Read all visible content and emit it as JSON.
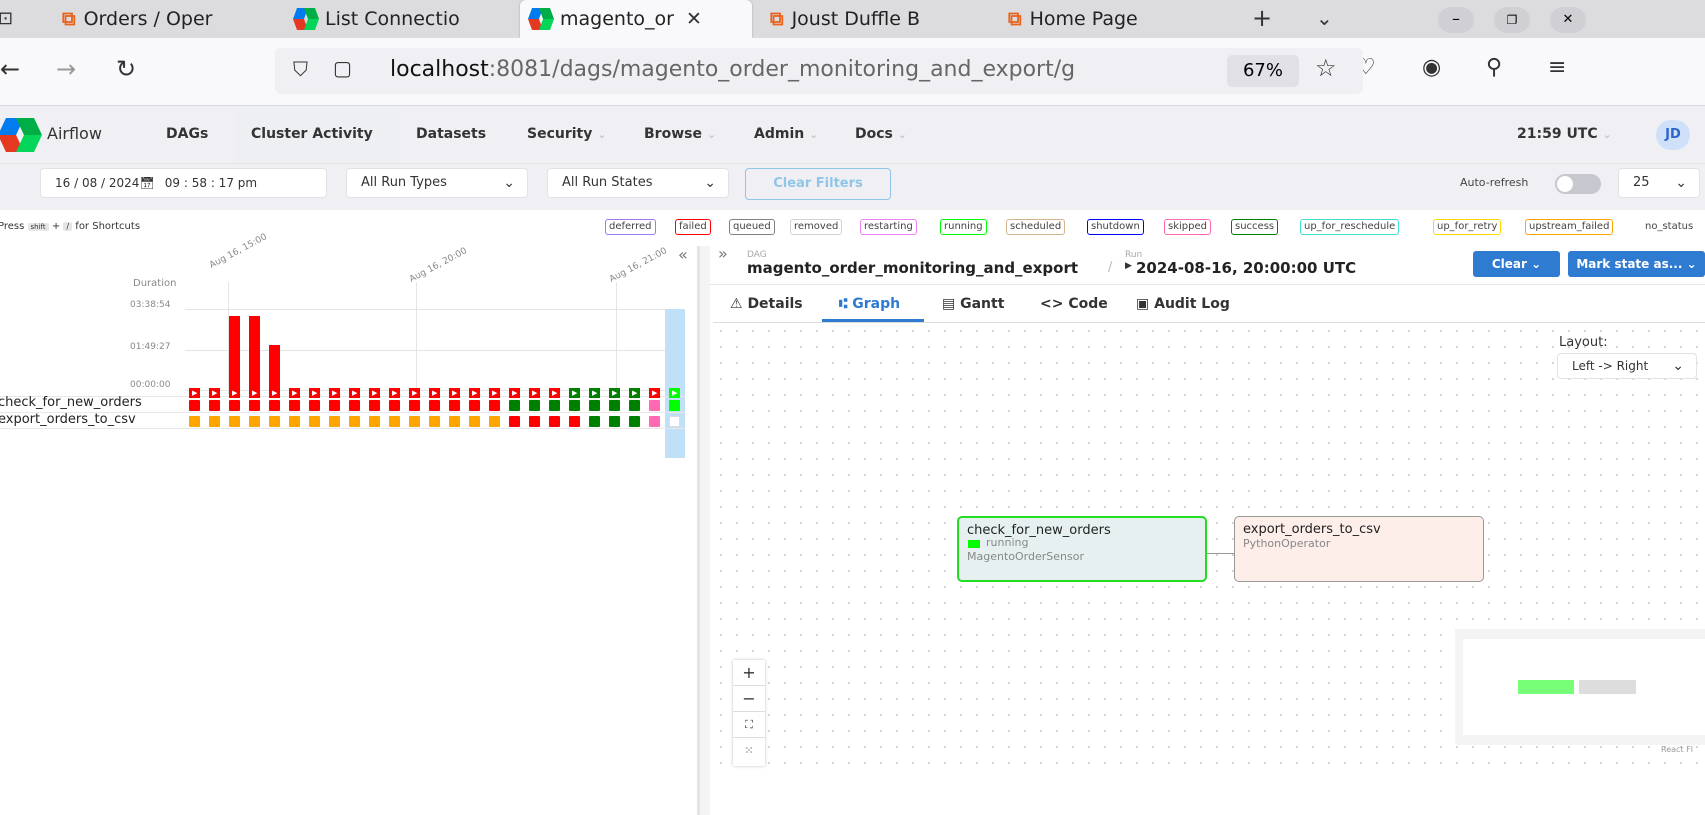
{
  "browser": {
    "tabs": [
      {
        "label": "Orders / Oper",
        "icon": "magento-icon"
      },
      {
        "label": "List Connectio",
        "icon": "airflow-icon"
      },
      {
        "label": "magento_or",
        "icon": "airflow-icon",
        "active": true
      },
      {
        "label": "Joust Duffle B",
        "icon": "magento-icon"
      },
      {
        "label": "Home Page",
        "icon": "magento-icon"
      }
    ],
    "url_host": "localhost",
    "url_rest": ":8081/dags/magento_order_monitoring_and_export/",
    "url_cut": "g",
    "zoom": "67%"
  },
  "airflow": {
    "brand": "Airflow",
    "menu": [
      "DAGs",
      "Cluster Activity",
      "Datasets",
      "Security",
      "Browse",
      "Admin",
      "Docs"
    ],
    "time": "21:59 UTC",
    "user_initials": "JD"
  },
  "filters": {
    "datetime": "16 / 08 / 2024",
    "time": "09 : 58 : 17   pm",
    "run_types": "All Run Types",
    "run_states": "All Run States",
    "clear_filters": "Clear Filters",
    "auto_refresh_label": "Auto-refresh",
    "page_size": "25"
  },
  "shortcuts": {
    "press": "Press",
    "key1": "shift",
    "plus": "+",
    "key2": "/",
    "suffix": "for Shortcuts"
  },
  "legend": [
    {
      "label": "deferred",
      "color": "#9a7bf2"
    },
    {
      "label": "failed",
      "color": "#ff0000"
    },
    {
      "label": "queued",
      "color": "#808080"
    },
    {
      "label": "removed",
      "color": "#d3d3d3"
    },
    {
      "label": "restarting",
      "color": "#ee82ee"
    },
    {
      "label": "running",
      "color": "#00ff00"
    },
    {
      "label": "scheduled",
      "color": "#d2b48c"
    },
    {
      "label": "shutdown",
      "color": "#0000ff"
    },
    {
      "label": "skipped",
      "color": "#ff69b4"
    },
    {
      "label": "success",
      "color": "#008000"
    },
    {
      "label": "up_for_reschedule",
      "color": "#40e0d0"
    },
    {
      "label": "up_for_retry",
      "color": "#ffd700"
    },
    {
      "label": "upstream_failed",
      "color": "#ffa500"
    },
    {
      "label": "no_status",
      "color": "#ffffff"
    }
  ],
  "grid": {
    "duration_label": "Duration",
    "y_ticks": [
      "03:38:54",
      "01:49:27",
      "00:00:00"
    ],
    "date_labels": [
      "Aug 16, 15:00",
      "Aug 16, 20:00",
      "Aug 16, 21:00"
    ],
    "run_durations": [
      0,
      0,
      1.0,
      1.0,
      0.65,
      0,
      0,
      0,
      0,
      0,
      0,
      0,
      0,
      0,
      0,
      0,
      0,
      0,
      0,
      0,
      0,
      0,
      0,
      0,
      0
    ],
    "run_colors": [
      "r",
      "r",
      "r",
      "r",
      "r",
      "r",
      "r",
      "r",
      "r",
      "r",
      "r",
      "r",
      "r",
      "r",
      "r",
      "r",
      "r",
      "r",
      "r",
      "g",
      "g",
      "g",
      "g",
      "r",
      "l"
    ],
    "tasks": [
      {
        "name": "check_for_new_orders",
        "states": [
          "r",
          "r",
          "r",
          "r",
          "r",
          "r",
          "r",
          "r",
          "r",
          "r",
          "r",
          "r",
          "r",
          "r",
          "r",
          "r",
          "g",
          "g",
          "g",
          "g",
          "g",
          "g",
          "g",
          "p",
          "l"
        ]
      },
      {
        "name": "export_orders_to_csv",
        "states": [
          "o",
          "o",
          "o",
          "o",
          "o",
          "o",
          "o",
          "o",
          "o",
          "o",
          "o",
          "o",
          "o",
          "o",
          "o",
          "o",
          "r",
          "r",
          "r",
          "r",
          "g",
          "g",
          "g",
          "p",
          "w"
        ]
      }
    ]
  },
  "details": {
    "dag_caption": "DAG",
    "dag_id": "magento_order_monitoring_and_export",
    "run_caption": "Run",
    "run_id": "2024-08-16, 20:00:00 UTC",
    "clear_label": "Clear",
    "mark_label": "Mark state as...",
    "tabs": [
      "Details",
      "Graph",
      "Gantt",
      "Code",
      "Audit Log"
    ],
    "layout_label": "Layout:",
    "layout_value": "Left -> Right",
    "react_flow": "React Fl"
  },
  "nodes": [
    {
      "task": "check_for_new_orders",
      "state": "running",
      "operator": "MagentoOrderSensor"
    },
    {
      "task": "export_orders_to_csv",
      "state": "",
      "operator": "PythonOperator"
    }
  ],
  "colors": {
    "r": "#ff0000",
    "g": "#008000",
    "o": "#ffa500",
    "p": "#ff69b4",
    "l": "#00ff00",
    "w": "#ffffff",
    "accent": "#2f7bd1"
  }
}
